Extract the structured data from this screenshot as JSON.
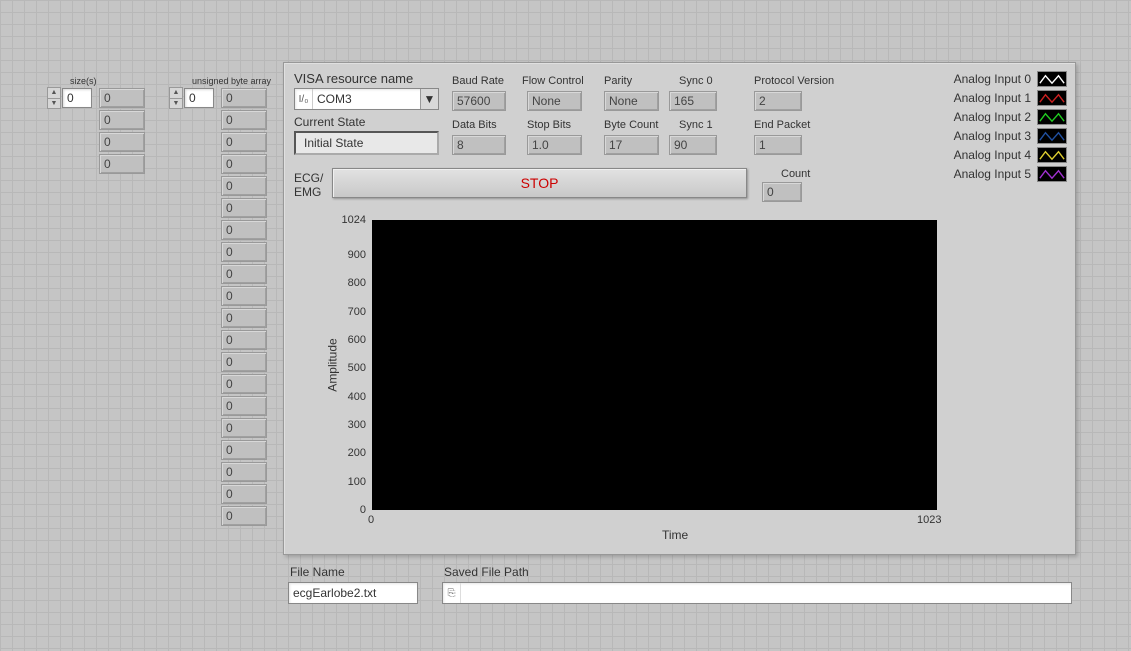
{
  "sizes": {
    "label": "size(s)",
    "index": "0",
    "items": [
      "0",
      "0",
      "0",
      "0"
    ]
  },
  "ubytes": {
    "label": "unsigned byte array",
    "index": "0",
    "items": [
      "0",
      "0",
      "0",
      "0",
      "0",
      "0",
      "0",
      "0",
      "0",
      "0",
      "0",
      "0",
      "0",
      "0",
      "0",
      "0",
      "0",
      "0",
      "0",
      "0"
    ]
  },
  "visa": {
    "label": "VISA resource name",
    "value": "COM3"
  },
  "state": {
    "label": "Current State",
    "value": "Initial State"
  },
  "params": {
    "baud": {
      "label": "Baud Rate",
      "value": "57600"
    },
    "flow": {
      "label": "Flow Control",
      "value": "None"
    },
    "parity": {
      "label": "Parity",
      "value": "None"
    },
    "sync0": {
      "label": "Sync 0",
      "value": "165"
    },
    "pver": {
      "label": "Protocol Version",
      "value": "2"
    },
    "databits": {
      "label": "Data Bits",
      "value": "8"
    },
    "stopbits": {
      "label": "Stop Bits",
      "value": "1.0"
    },
    "bytecnt": {
      "label": "Byte Count",
      "value": "17"
    },
    "sync1": {
      "label": "Sync 1",
      "value": "90"
    },
    "endpkt": {
      "label": "End Packet",
      "value": "1"
    },
    "count": {
      "label": "Count",
      "value": "0"
    }
  },
  "ecg": {
    "label1": "ECG/",
    "label2": "EMG",
    "button": "STOP"
  },
  "legend": [
    {
      "label": "Analog Input 0",
      "color": "#ffffff"
    },
    {
      "label": "Analog Input 1",
      "color": "#cc2020"
    },
    {
      "label": "Analog Input 2",
      "color": "#20cc20"
    },
    {
      "label": "Analog Input 3",
      "color": "#2050a0"
    },
    {
      "label": "Analog Input 4",
      "color": "#ddcc30"
    },
    {
      "label": "Analog Input 5",
      "color": "#a030d0"
    }
  ],
  "chart_data": {
    "type": "line",
    "title": "",
    "xlabel": "Time",
    "ylabel": "Amplitude",
    "xlim": [
      0,
      1023
    ],
    "ylim": [
      0,
      1024
    ],
    "yticks": [
      0,
      100,
      200,
      300,
      400,
      500,
      600,
      700,
      800,
      900,
      1024
    ],
    "xticks": [
      0,
      1023
    ],
    "series": [
      {
        "name": "Analog Input 0",
        "values": []
      },
      {
        "name": "Analog Input 1",
        "values": []
      },
      {
        "name": "Analog Input 2",
        "values": []
      },
      {
        "name": "Analog Input 3",
        "values": []
      },
      {
        "name": "Analog Input 4",
        "values": []
      },
      {
        "name": "Analog Input 5",
        "values": []
      }
    ]
  },
  "file": {
    "name_label": "File Name",
    "name_value": "ecgEarlobe2.txt",
    "path_label": "Saved File Path",
    "path_value": ""
  }
}
